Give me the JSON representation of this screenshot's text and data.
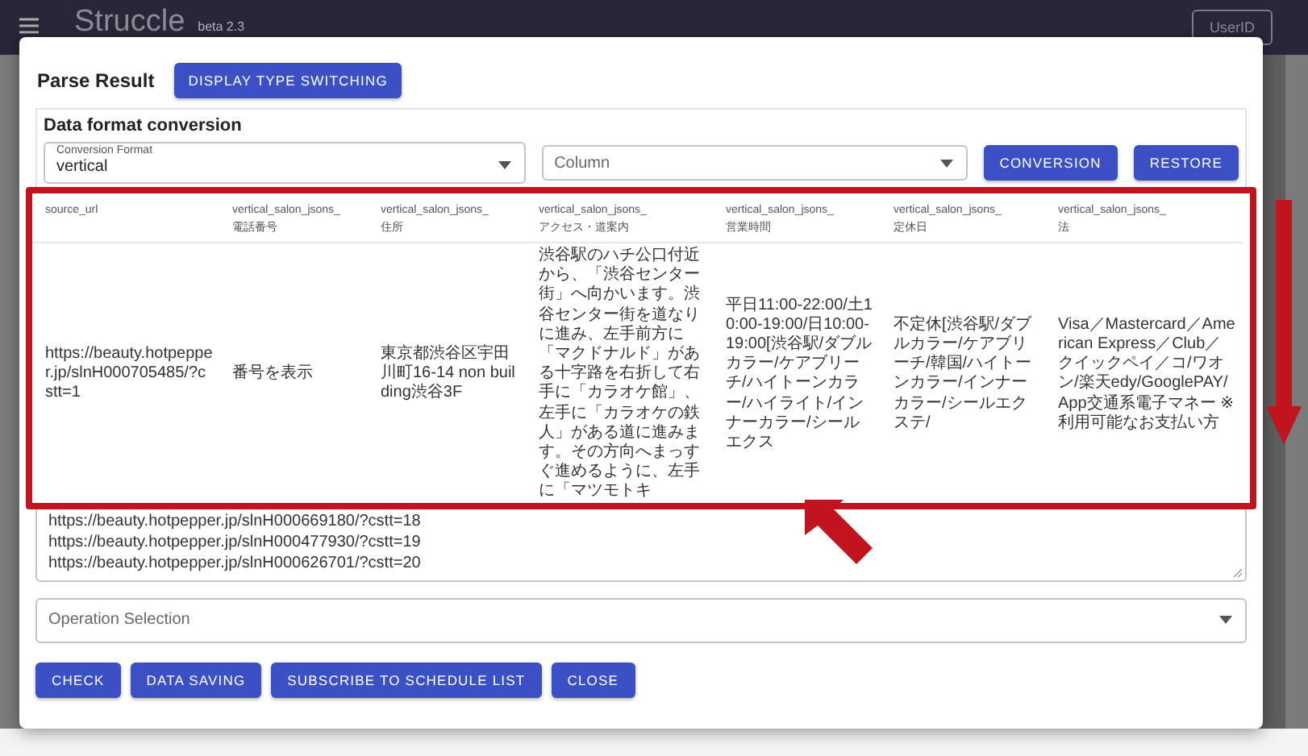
{
  "app_header": {
    "title": "Struccle",
    "version": "beta 2.3",
    "user_button": "UserID"
  },
  "dialog": {
    "title": "Parse Result",
    "switch_button": "DISPLAY TYPE SWITCHING",
    "conversion": {
      "heading": "Data format conversion",
      "format_select": {
        "label": "Conversion Format",
        "value": "vertical"
      },
      "column_select": {
        "placeholder": "Column"
      },
      "buttons": [
        "CONVERSION",
        "RESTORE"
      ]
    },
    "table": {
      "columns": [
        {
          "line1": "source_url"
        },
        {
          "line1": "vertical_salon_jsons_",
          "line2": "電話番号"
        },
        {
          "line1": "vertical_salon_jsons_",
          "line2": "住所"
        },
        {
          "line1": "vertical_salon_jsons_",
          "line2": "アクセス・道案内"
        },
        {
          "line1": "vertical_salon_jsons_",
          "line2": "営業時間"
        },
        {
          "line1": "vertical_salon_jsons_",
          "line2": "定休日"
        },
        {
          "line1": "vertical_salon_jsons_",
          "line2": "法"
        }
      ],
      "rows": [
        [
          "https://beauty.hotpepper.jp/slnH000705485/?cstt=1",
          "番号を表示",
          "東京都渋谷区宇田川町16-14 non building渋谷3F",
          "渋谷駅のハチ公口付近から、「渋谷センター街」へ向かいます。渋谷センター街を道なりに進み、左手前方に「マクドナルド」がある十字路を右折して右手に「カラオケ館」、左手に「カラオケの鉄人」がある道に進みます。その方向へまっすぐ進めるように、左手に「マツモトキ",
          "平日11:00-22:00/土10:00-19:00/日10:00-19:00[渋谷駅/ダブルカラー/ケアブリーチ/ハイトーンカラー/ハイライト/インナーカラー/シールエクス",
          "不定休[渋谷駅/ダブルカラー/ケアブリーチ/韓国/ハイトーンカラー/インナーカラー/シールエクステ/",
          "Visa／Mastercard／American Express／Club／クイックペイ／コ/ワオン/楽天edy/GooglePAY/App交通系電子マネー ※利用可能なお支払い方"
        ]
      ]
    },
    "url_list": {
      "lines": [
        "https://beauty.hotpepper.jp/slnH000669180/?cstt=18",
        "https://beauty.hotpepper.jp/slnH000477930/?cstt=19",
        "https://beauty.hotpepper.jp/slnH000626701/?cstt=20"
      ]
    },
    "operation_select": {
      "placeholder": "Operation Selection"
    },
    "buttons": [
      "CHECK",
      "DATA SAVING",
      "SUBSCRIBE TO SCHEDULE LIST",
      "CLOSE"
    ]
  }
}
